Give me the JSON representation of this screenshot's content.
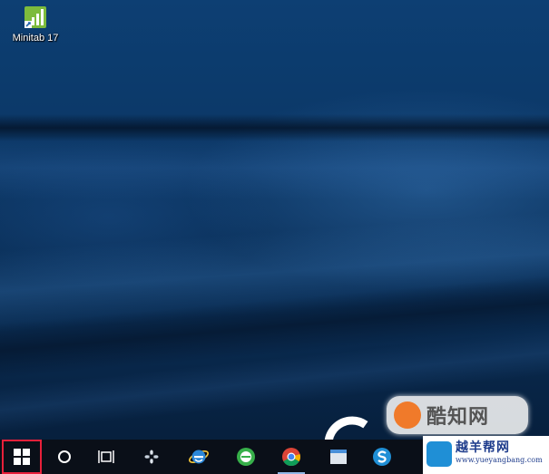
{
  "desktop": {
    "icons": [
      {
        "label": "Minitab 17",
        "icon": "minitab-icon"
      }
    ]
  },
  "taskbar": {
    "start": {
      "icon": "windows-logo-icon",
      "highlighted": true,
      "highlight_color": "#e8203a"
    },
    "items": [
      {
        "name": "cortana-search",
        "icon": "circle-icon"
      },
      {
        "name": "task-view",
        "icon": "task-view-icon"
      },
      {
        "name": "pinwheel-app",
        "icon": "pinwheel-icon"
      },
      {
        "name": "internet-explorer",
        "icon": "ie-icon"
      },
      {
        "name": "green-browser",
        "icon": "green-e-icon"
      },
      {
        "name": "google-chrome",
        "icon": "chrome-icon"
      },
      {
        "name": "unknown-app",
        "icon": "window-icon"
      },
      {
        "name": "sogou",
        "icon": "s-icon"
      }
    ]
  },
  "watermarks": {
    "kuzhi": {
      "text": "酷知网"
    },
    "yueyang": {
      "title": "越羊帮网",
      "url": "www.yueyangbang.com"
    }
  },
  "colors": {
    "taskbar": "#0a0f18",
    "wallpaper_primary": "#0c3a6b",
    "accent_blue": "#1f8fd6"
  }
}
